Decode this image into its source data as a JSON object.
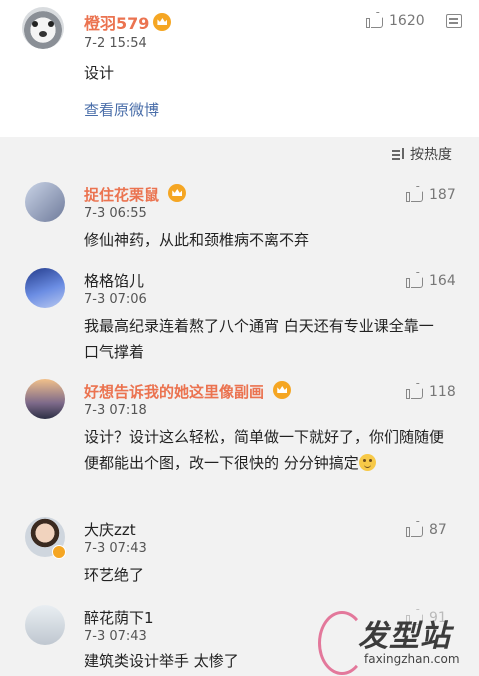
{
  "post": {
    "username": "橙羽579",
    "time": "7-2 15:54",
    "content": "设计",
    "view_link": "查看原微博",
    "likes": "1620"
  },
  "sort_label": "按热度",
  "comments": [
    {
      "username": "捉住花栗鼠",
      "time": "7-3 06:55",
      "text": "修仙神药，从此和颈椎病不离不弃",
      "likes": "187"
    },
    {
      "username": "格格馅儿",
      "time": "7-3 07:06",
      "text": "我最高纪录连着熬了八个通宵 白天还有专业课全靠一口气撑着",
      "likes": "164"
    },
    {
      "username": "好想告诉我的她这里像副画",
      "time": "7-3 07:18",
      "text": "设计？设计这么轻松，简单做一下就好了，你们随随便便都能出个图，改一下很快的 分分钟搞定",
      "likes": "118"
    },
    {
      "username": "大庆zzt",
      "time": "7-3 07:43",
      "text": "环艺绝了",
      "likes": "87"
    },
    {
      "username": "醉花荫下1",
      "time": "7-3 07:43",
      "text": "建筑类设计举手 太惨了",
      "likes": "91"
    }
  ],
  "watermark": {
    "logo_text": "发型站",
    "url": "faxingzhan.com"
  }
}
